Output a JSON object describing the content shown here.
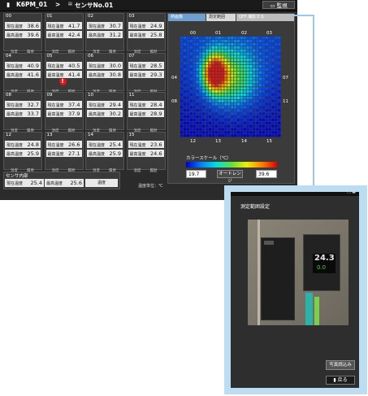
{
  "header": {
    "device": "K6PM_01",
    "separator": ">",
    "sensor": "センサNo.01",
    "monitor_button": "監視"
  },
  "tiles": [
    {
      "id": "00",
      "current_label": "現在温度",
      "current": "38.6",
      "max_label": "最高温度",
      "max": "39.6",
      "foot_left": "温度",
      "foot_right": "履歴",
      "warning": false
    },
    {
      "id": "01",
      "current_label": "現在温度",
      "current": "41.7",
      "max_label": "最高温度",
      "max": "42.4",
      "foot_left": "温度",
      "foot_right": "履歴",
      "warning": false
    },
    {
      "id": "02",
      "current_label": "現在温度",
      "current": "30.7",
      "max_label": "最高温度",
      "max": "31.2",
      "foot_left": "温度",
      "foot_right": "履歴",
      "warning": false
    },
    {
      "id": "03",
      "current_label": "現在温度",
      "current": "24.9",
      "max_label": "最高温度",
      "max": "25.8",
      "foot_left": "温度",
      "foot_right": "履歴",
      "warning": false
    },
    {
      "id": "04",
      "current_label": "現在温度",
      "current": "40.9",
      "max_label": "最高温度",
      "max": "41.6",
      "foot_left": "温度",
      "foot_right": "履歴",
      "warning": false
    },
    {
      "id": "05",
      "current_label": "現在温度",
      "current": "40.5",
      "max_label": "最高温度",
      "max": "41.4",
      "foot_left": "温度",
      "foot_right": "履歴",
      "warning": true
    },
    {
      "id": "06",
      "current_label": "現在温度",
      "current": "30.0",
      "max_label": "最高温度",
      "max": "30.8",
      "foot_left": "温度",
      "foot_right": "履歴",
      "warning": false
    },
    {
      "id": "07",
      "current_label": "現在温度",
      "current": "28.5",
      "max_label": "最高温度",
      "max": "29.3",
      "foot_left": "温度",
      "foot_right": "履歴",
      "warning": false
    },
    {
      "id": "08",
      "current_label": "現在温度",
      "current": "32.7",
      "max_label": "最高温度",
      "max": "33.7",
      "foot_left": "温度",
      "foot_right": "履歴",
      "warning": false
    },
    {
      "id": "09",
      "current_label": "現在温度",
      "current": "37.4",
      "max_label": "最高温度",
      "max": "37.9",
      "foot_left": "温度",
      "foot_right": "履歴",
      "warning": false
    },
    {
      "id": "10",
      "current_label": "現在温度",
      "current": "29.4",
      "max_label": "最高温度",
      "max": "30.2",
      "foot_left": "温度",
      "foot_right": "履歴",
      "warning": false
    },
    {
      "id": "11",
      "current_label": "現在温度",
      "current": "28.4",
      "max_label": "最高温度",
      "max": "28.9",
      "foot_left": "温度",
      "foot_right": "履歴",
      "warning": false
    },
    {
      "id": "12",
      "current_label": "現在温度",
      "current": "24.8",
      "max_label": "最高温度",
      "max": "25.9",
      "foot_left": "温度",
      "foot_right": "履歴",
      "warning": false
    },
    {
      "id": "13",
      "current_label": "現在温度",
      "current": "26.6",
      "max_label": "最高温度",
      "max": "27.1",
      "foot_left": "温度",
      "foot_right": "履歴",
      "warning": false
    },
    {
      "id": "14",
      "current_label": "現在温度",
      "current": "25.4",
      "max_label": "最高温度",
      "max": "25.9",
      "foot_left": "温度",
      "foot_right": "履歴",
      "warning": false
    },
    {
      "id": "15",
      "current_label": "現在温度",
      "current": "23.6",
      "max_label": "最高温度",
      "max": "24.6",
      "foot_left": "温度",
      "foot_right": "履歴",
      "warning": false
    }
  ],
  "sensor_internal": {
    "heading": "センサ内部",
    "current_label": "現在温度",
    "current": "25.4",
    "max_label": "最高温度",
    "max": "25.6",
    "button": "温度"
  },
  "unit_note": "温度単位：℃",
  "thermo": {
    "tabs": [
      "熱画像",
      "測定範囲",
      "OFF 撮影する"
    ],
    "col_labels": [
      "00",
      "01",
      "02",
      "03"
    ],
    "row_labels_left": [
      "04",
      "08"
    ],
    "row_labels_right": [
      "07",
      "11"
    ],
    "bottom_labels": [
      "12",
      "13",
      "14",
      "15"
    ],
    "scale_label": "カラースケール（℃）",
    "min": "19.7",
    "max": "39.6",
    "auto_button": "オートレンジ"
  },
  "dialog": {
    "title": "測定範囲設定",
    "photo_reading_top": "24.3",
    "photo_reading_bottom": "0.0",
    "capture_button": "写真読込み",
    "back_button": "戻る"
  }
}
